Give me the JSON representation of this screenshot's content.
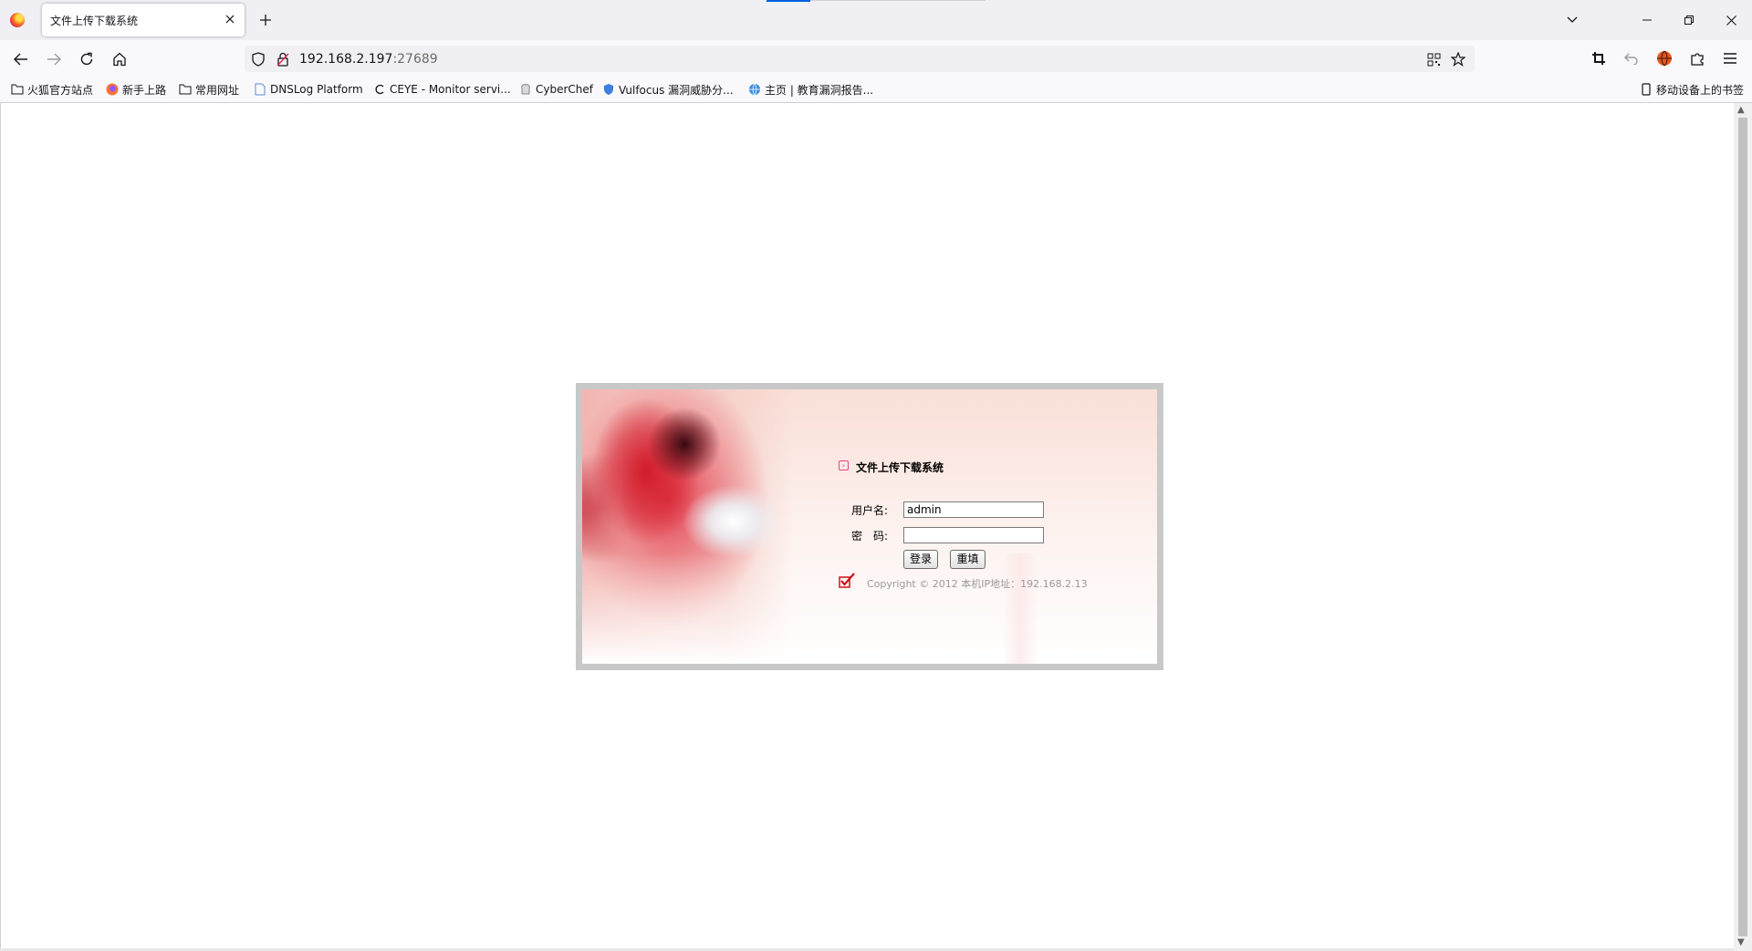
{
  "browser": {
    "tab_title": "文件上传下载系统",
    "url_host": "192.168.2.197",
    "url_port": ":27689",
    "bookmarks": [
      {
        "label": "火狐官方站点",
        "icon": "folder-icon"
      },
      {
        "label": "新手上路",
        "icon": "firefox-icon"
      },
      {
        "label": "常用网址",
        "icon": "folder-icon"
      },
      {
        "label": "DNSLog Platform",
        "icon": "page-icon"
      },
      {
        "label": "CEYE - Monitor servi...",
        "icon": "ceye-icon"
      },
      {
        "label": "CyberChef",
        "icon": "chef-icon"
      },
      {
        "label": "Vulfocus 漏洞威胁分...",
        "icon": "shield-icon"
      },
      {
        "label": "主页 | 教育漏洞报告...",
        "icon": "globe-icon"
      }
    ],
    "mobile_bookmarks": "移动设备上的书签"
  },
  "login": {
    "title": "文件上传下载系统",
    "username_label": "用户名:",
    "password_label": "密　码:",
    "username_value": "admin",
    "password_value": "",
    "login_button": "登录",
    "reset_button": "重填",
    "copyright": "Copyright © 2012 本机IP地址：192.168.2.13"
  },
  "colors": {
    "accent": "#0060df",
    "frame": "#c8c8c8",
    "copyright_text": "#9a9a9a",
    "check_red": "#d0101a"
  }
}
